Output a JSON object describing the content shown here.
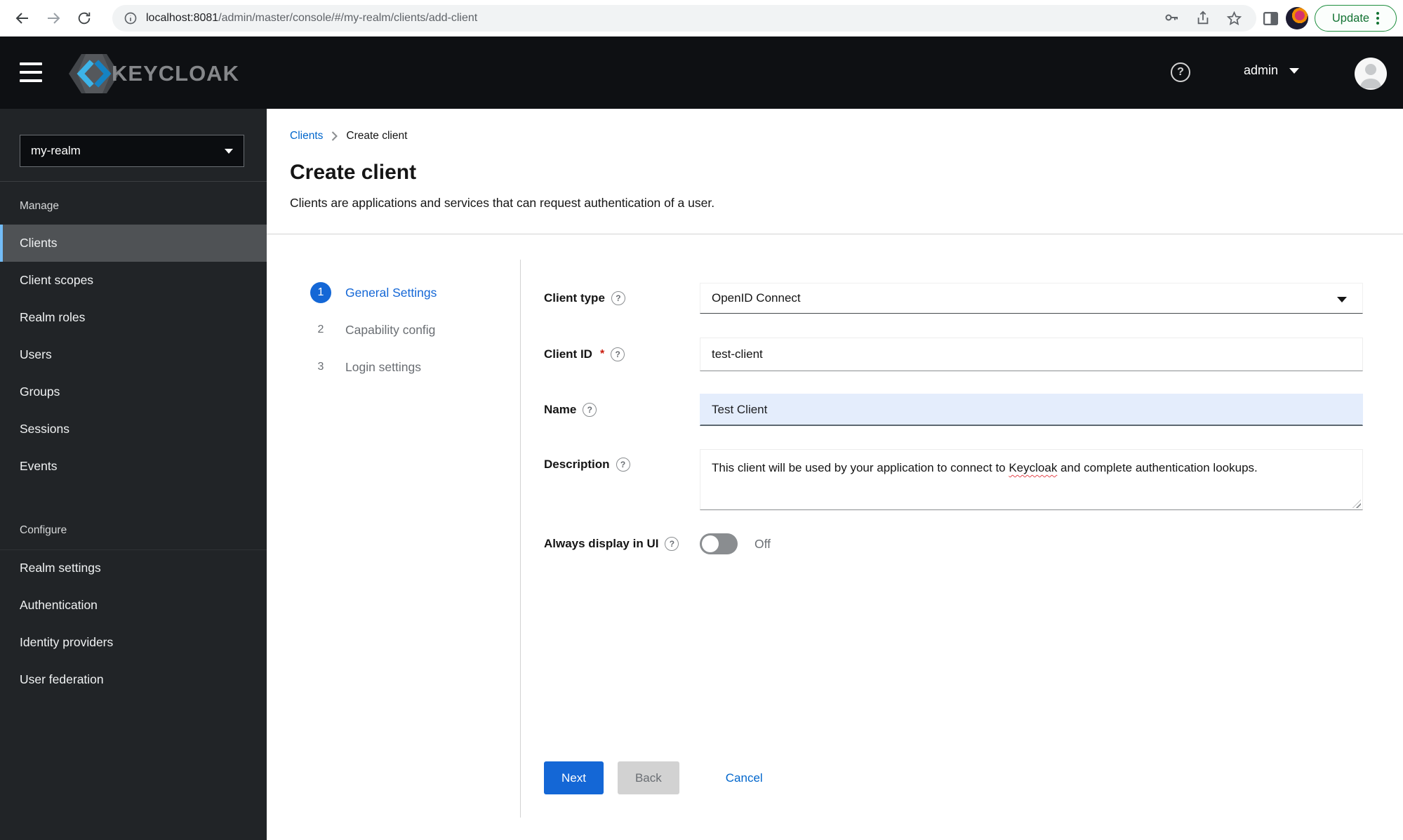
{
  "browser": {
    "url_host": "localhost:8081",
    "url_path": "/admin/master/console/#/my-realm/clients/add-client",
    "update_label": "Update"
  },
  "header": {
    "brand": "KEYCLOAK",
    "username": "admin"
  },
  "icons": {
    "help_glyph": "?"
  },
  "sidebar": {
    "realm": "my-realm",
    "manage_title": "Manage",
    "configure_title": "Configure",
    "manage_items": [
      "Clients",
      "Client scopes",
      "Realm roles",
      "Users",
      "Groups",
      "Sessions",
      "Events"
    ],
    "configure_items": [
      "Realm settings",
      "Authentication",
      "Identity providers",
      "User federation"
    ],
    "active_item": "Clients",
    "active_accent_color": "#73bcf7"
  },
  "breadcrumb": {
    "parent": "Clients",
    "current": "Create client"
  },
  "page": {
    "title": "Create client",
    "subtitle": "Clients are applications and services that can request authentication of a user."
  },
  "wizard": {
    "steps": [
      {
        "number": "1",
        "label": "General Settings",
        "active": true
      },
      {
        "number": "2",
        "label": "Capability config",
        "active": false
      },
      {
        "number": "3",
        "label": "Login settings",
        "active": false
      }
    ]
  },
  "form": {
    "client_type": {
      "label": "Client type",
      "value": "OpenID Connect"
    },
    "client_id": {
      "label": "Client ID",
      "required_marker": "*",
      "value": "test-client"
    },
    "name": {
      "label": "Name",
      "value": "Test Client"
    },
    "description": {
      "label": "Description",
      "text_before": "This client will be used by your application to connect to ",
      "text_misspelled": "Keycloak",
      "text_after": " and complete authentication lookups."
    },
    "always_display": {
      "label": "Always display in UI",
      "state": "Off"
    }
  },
  "actions": {
    "next": "Next",
    "back": "Back",
    "cancel": "Cancel"
  },
  "colors": {
    "primary_blue": "#1467d6",
    "link_blue": "#0066cc",
    "nav_active_border": "#73bcf7",
    "required_red": "#c9190b"
  }
}
